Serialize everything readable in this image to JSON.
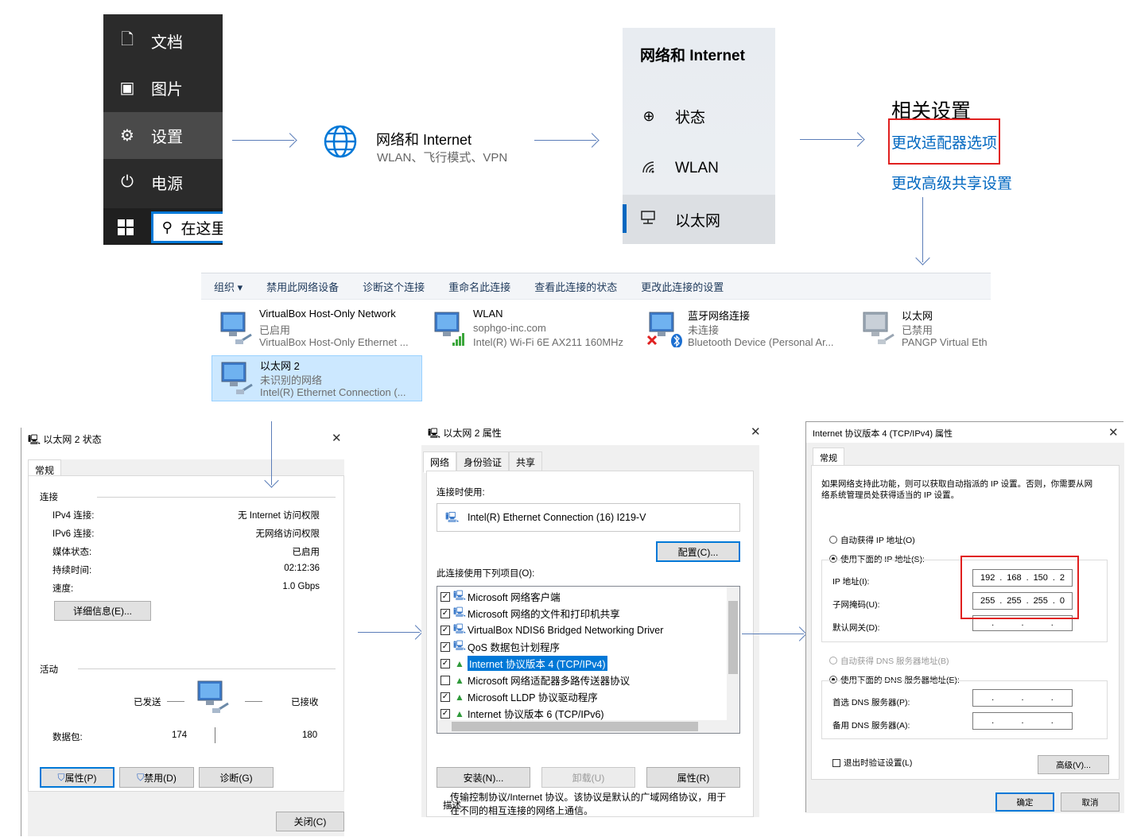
{
  "start_menu": {
    "items": [
      {
        "icon": "document-icon",
        "glyph": "🗋",
        "label": "文档"
      },
      {
        "icon": "picture-icon",
        "glyph": "🖼",
        "label": "图片"
      },
      {
        "icon": "gear-icon",
        "glyph": "⚙",
        "label": "设置"
      },
      {
        "icon": "power-icon",
        "glyph": "⏻",
        "label": "电源"
      }
    ],
    "search_placeholder": "在这里"
  },
  "network_tile": {
    "title": "网络和 Internet",
    "subtitle": "WLAN、飞行模式、VPN"
  },
  "settings_nav": {
    "title": "网络和 Internet",
    "items": [
      {
        "icon": "globe-status-icon",
        "glyph": "🌐",
        "label": "状态"
      },
      {
        "icon": "wifi-icon",
        "glyph": "◞",
        "label": "WLAN"
      },
      {
        "icon": "ethernet-icon",
        "glyph": "🖳",
        "label": "以太网"
      }
    ]
  },
  "related_settings": {
    "title": "相关设置",
    "link_adapter": "更改适配器选项",
    "link_sharing": "更改高级共享设置"
  },
  "connections": {
    "toolbar": [
      "组织 ▾",
      "禁用此网络设备",
      "诊断这个连接",
      "重命名此连接",
      "查看此连接的状态",
      "更改此连接的设置"
    ],
    "adapters": [
      {
        "name": "VirtualBox Host-Only Network",
        "status": "已启用",
        "device": "VirtualBox Host-Only Ethernet ..."
      },
      {
        "name": "WLAN",
        "status": "sophgo-inc.com",
        "device": "Intel(R) Wi-Fi 6E AX211 160MHz"
      },
      {
        "name": "蓝牙网络连接",
        "status": "未连接",
        "device": "Bluetooth Device (Personal Ar..."
      },
      {
        "name": "以太网",
        "status": "已禁用",
        "device": "PANGP Virtual Eth"
      },
      {
        "name": "以太网 2",
        "status": "未识别的网络",
        "device": "Intel(R) Ethernet Connection (..."
      }
    ]
  },
  "status_dialog": {
    "title": "以太网 2 状态",
    "tab": "常规",
    "section_connection": "连接",
    "rows": [
      {
        "label": "IPv4 连接:",
        "value": "无 Internet 访问权限"
      },
      {
        "label": "IPv6 连接:",
        "value": "无网络访问权限"
      },
      {
        "label": "媒体状态:",
        "value": "已启用"
      },
      {
        "label": "持续时间:",
        "value": "02:12:36"
      },
      {
        "label": "速度:",
        "value": "1.0 Gbps"
      }
    ],
    "details_button": "详细信息(E)...",
    "section_activity": "活动",
    "sent_label": "已发送",
    "received_label": "已接收",
    "packets_label": "数据包:",
    "packets_sent": "174",
    "packets_received": "180",
    "btn_properties": "属性(P)",
    "btn_disable": "禁用(D)",
    "btn_diagnose": "诊断(G)",
    "btn_close": "关闭(C)"
  },
  "properties_dialog": {
    "title": "以太网 2 属性",
    "tabs": [
      "网络",
      "身份验证",
      "共享"
    ],
    "connect_using_label": "连接时使用:",
    "adapter_name": "Intel(R) Ethernet Connection (16) I219-V",
    "configure_button": "配置(C)...",
    "items_label": "此连接使用下列项目(O):",
    "items": [
      {
        "checked": "✓",
        "label": "Microsoft 网络客户端"
      },
      {
        "checked": "✓",
        "label": "Microsoft 网络的文件和打印机共享"
      },
      {
        "checked": "✓",
        "label": "VirtualBox NDIS6 Bridged Networking Driver"
      },
      {
        "checked": "✓",
        "label": "QoS 数据包计划程序"
      },
      {
        "checked": "✓",
        "label": "Internet 协议版本 4 (TCP/IPv4)"
      },
      {
        "checked": "",
        "label": "Microsoft 网络适配器多路传送器协议"
      },
      {
        "checked": "✓",
        "label": "Microsoft LLDP 协议驱动程序"
      },
      {
        "checked": "✓",
        "label": "Internet 协议版本 6 (TCP/IPv6)"
      }
    ],
    "btn_install": "安装(N)...",
    "btn_uninstall": "卸载(U)",
    "btn_properties": "属性(R)",
    "description_label": "描述",
    "description": "传输控制协议/Internet 协议。该协议是默认的广域网络协议，用于在不同的相互连接的网络上通信。"
  },
  "ipv4_dialog": {
    "title": "Internet 协议版本 4 (TCP/IPv4) 属性",
    "tab": "常规",
    "intro": "如果网络支持此功能，则可以获取自动指派的 IP 设置。否则，你需要从网络系统管理员处获得适当的 IP 设置。",
    "auto_ip": "自动获得 IP 地址(O)",
    "manual_ip": "使用下面的 IP 地址(S):",
    "ip_label": "IP 地址(I):",
    "ip_value": [
      "192",
      "168",
      "150",
      "2"
    ],
    "mask_label": "子网掩码(U):",
    "mask_value": [
      "255",
      "255",
      "255",
      "0"
    ],
    "gateway_label": "默认网关(D):",
    "auto_dns": "自动获得 DNS 服务器地址(B)",
    "manual_dns": "使用下面的 DNS 服务器地址(E):",
    "dns1_label": "首选 DNS 服务器(P):",
    "dns2_label": "备用 DNS 服务器(A):",
    "validate_label": "退出时验证设置(L)",
    "advanced_button": "高级(V)...",
    "ok_button": "确定",
    "cancel_button": "取消"
  }
}
